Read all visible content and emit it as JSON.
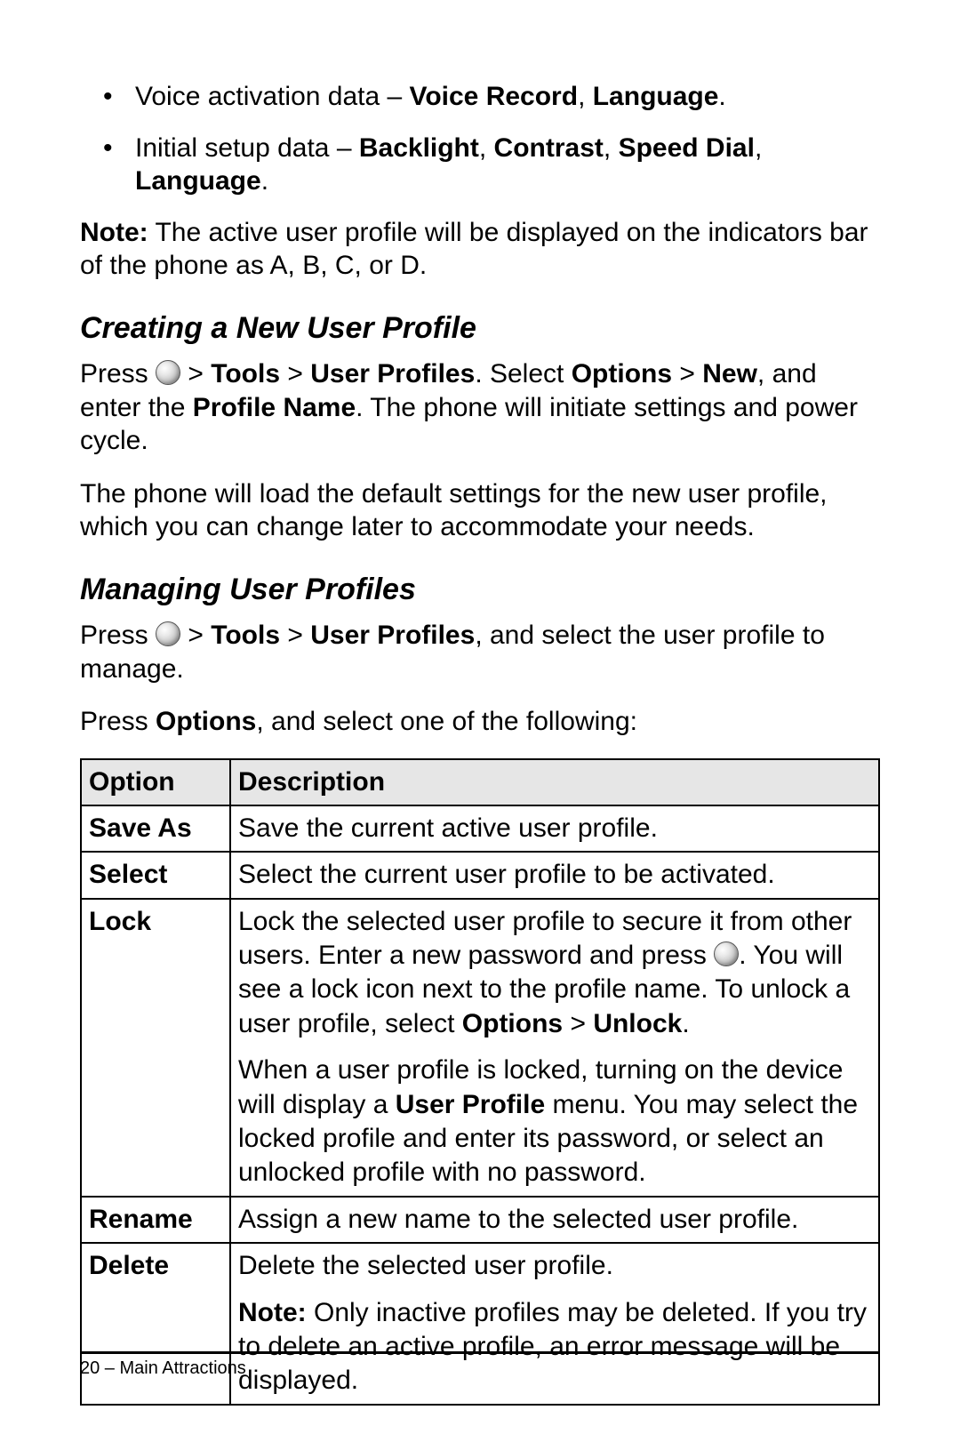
{
  "bullets": {
    "b1_pre": "Voice activation data – ",
    "b1_bold": "Voice Record",
    "b1_sep": ", ",
    "b1_bold2": "Language",
    "b1_post": ".",
    "b2_pre": "Initial setup data – ",
    "b2_bold": "Backlight",
    "b2_sep": ", ",
    "b2_bold2": "Contrast",
    "b2_sep2": ", ",
    "b2_bold3": "Speed Dial",
    "b2_sep3": ", ",
    "b2_bold4": "Language",
    "b2_post": "."
  },
  "note1": {
    "label": "Note:",
    "text": " The active user profile will be displayed on the indicators bar of the phone as A, B, C, or D."
  },
  "sections": {
    "create_title": "Creating a New User Profile",
    "create_p1_pre": "Press ",
    "create_p1_gt1": " > ",
    "create_p1_tools": "Tools",
    "create_p1_gt2": " > ",
    "create_p1_up": "User Profiles",
    "create_p1_sel": ". Select ",
    "create_p1_opt": "Options",
    "create_p1_gt3": " > ",
    "create_p1_new": "New",
    "create_p1_mid": ", and enter the ",
    "create_p1_pn": "Profile Name",
    "create_p1_post": ". The phone will initiate settings and power cycle.",
    "create_p2": "The phone will load the default settings for the new user profile, which you can change later to accommodate your needs.",
    "manage_title": "Managing User Profiles",
    "manage_p1_pre": "Press ",
    "manage_p1_gt1": " > ",
    "manage_p1_tools": "Tools",
    "manage_p1_gt2": " > ",
    "manage_p1_up": "User Profiles",
    "manage_p1_post": ", and select the user profile to manage.",
    "manage_p2_pre": "Press ",
    "manage_p2_opt": "Options",
    "manage_p2_post": ", and select one of the following:"
  },
  "table": {
    "h_option": "Option",
    "h_desc": "Description",
    "r1_opt": "Save As",
    "r1_desc": "Save the current active user profile.",
    "r2_opt": "Select",
    "r2_desc": "Select the current user profile to be activated.",
    "r3_opt": "Lock",
    "r3_p1a": "Lock the selected user profile to secure it from other users. Enter a new password and press ",
    "r3_p1b": ". You will see a lock icon next to the profile name. To unlock a user profile, select ",
    "r3_p1_opt": "Options",
    "r3_p1_gt": " > ",
    "r3_p1_unlock": "Unlock",
    "r3_p1c": ".",
    "r3_p2a": "When a user profile is locked, turning on the device will display a ",
    "r3_p2_up": "User Profile",
    "r3_p2b": " menu. You may select the locked profile and enter its password, or select an unlocked profile with no password.",
    "r4_opt": "Rename",
    "r4_desc": "Assign a new name to the selected user profile.",
    "r5_opt": "Delete",
    "r5_p1": "Delete the selected user profile.",
    "r5_p2_label": "Note:",
    "r5_p2_text": " Only inactive profiles may be deleted. If you try to delete an active profile, an error message will be displayed."
  },
  "footer": {
    "text": "20 – Main Attractions"
  }
}
